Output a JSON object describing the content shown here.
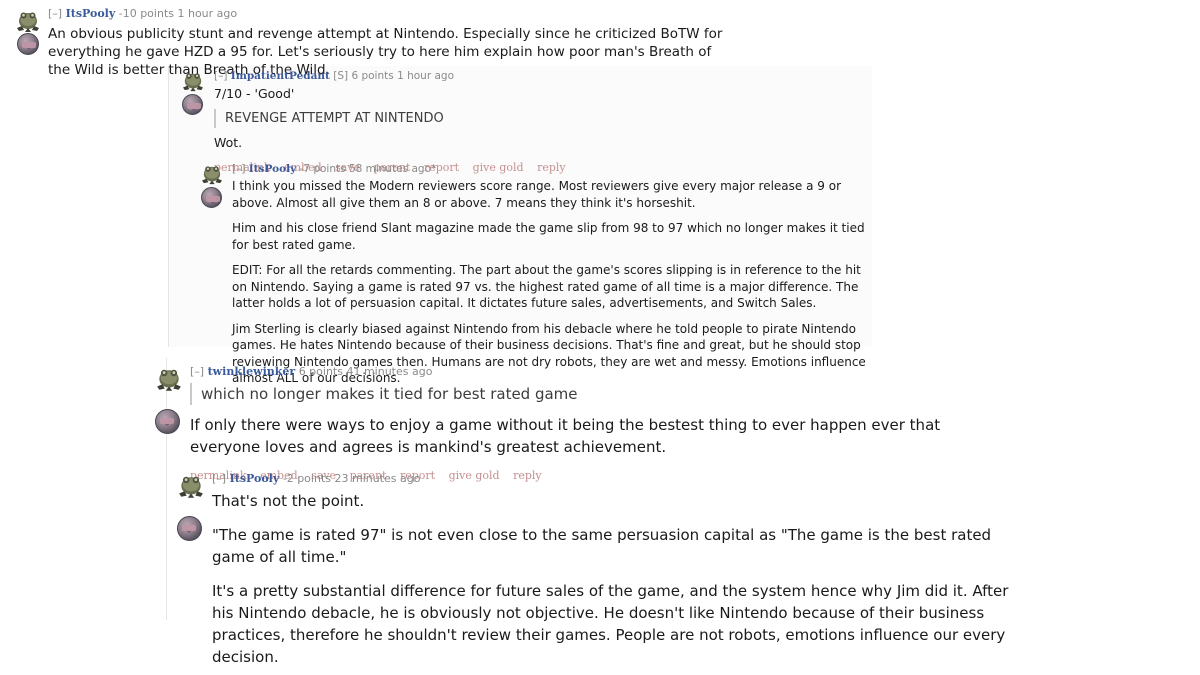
{
  "thread": {
    "comments": [
      {
        "id": "root",
        "collapse": "[–]",
        "author": "ItsPooly",
        "score": "-10 points",
        "time": "1 hour ago",
        "submitter": "",
        "body": [
          "An obvious publicity stunt and revenge attempt at Nintendo. Especially since he criticized BoTW for everything he gave HZD a 95 for. Let's seriously try to here him explain how poor man's Breath of the Wild is better than Breath of the Wild."
        ],
        "quote": "",
        "actions": []
      },
      {
        "id": "reply-1",
        "collapse": "[–]",
        "author": "ImpatientPedant",
        "submitter": "[S]",
        "score": "6 points",
        "time": "1 hour ago",
        "body_before_quote": "7/10 - 'Good'",
        "quote": "REVENGE ATTEMPT AT NINTENDO",
        "body_after_quote": "Wot.",
        "actions": [
          "permalink",
          "embed",
          "save",
          "parent",
          "report",
          "give gold",
          "reply"
        ]
      },
      {
        "id": "reply-2",
        "collapse": "[–]",
        "author": "ItsPooly",
        "submitter": "",
        "score": "-7 points",
        "time": "58 minutes ago*",
        "body": [
          "I think you missed the Modern reviewers score range. Most reviewers give every major release a 9 or above. Almost all give them an 8 or above. 7 means they think it's horseshit.",
          "Him and his close friend Slant magazine made the game slip from 98 to 97 which no longer makes it tied for best rated game.",
          "EDIT: For all the retards commenting. The part about the game's scores slipping is in reference to the hit on Nintendo. Saying a game is rated 97 vs. the highest rated game of all time is a major difference. The latter holds a lot of persuasion capital. It dictates future sales, advertisements, and Switch Sales.",
          "Jim Sterling is clearly biased against Nintendo from his debacle where he told people to pirate Nintendo games. He hates Nintendo because of their business decisions. That's fine and great, but he should stop reviewing Nintendo games then. Humans are not dry robots, they are wet and messy. Emotions influence almost ALL of our decisions."
        ],
        "actions": []
      },
      {
        "id": "reply-3",
        "collapse": "[–]",
        "author": "twinklewinker",
        "submitter": "",
        "score": "6 points",
        "time": "41 minutes ago",
        "quote": "which no longer makes it tied for best rated game",
        "body": [
          "If only there were ways to enjoy a game without it being the bestest thing to ever happen ever that everyone loves and agrees is mankind's greatest achievement."
        ],
        "actions": [
          "permalink",
          "embed",
          "save",
          "parent",
          "report",
          "give gold",
          "reply"
        ]
      },
      {
        "id": "reply-4",
        "collapse": "[–]",
        "author": "ItsPooly",
        "submitter": "",
        "score": "-2 points",
        "time": "23 minutes ago",
        "body": [
          "That's not the point.",
          "\"The game is rated 97\" is not even close to the same persuasion capital as \"The game is the best rated game of all time.\"",
          "It's a pretty substantial difference for future sales of the game, and the system hence why Jim did it. After his Nintendo debacle, he is obviously not objective. He doesn't like Nintendo because of their business practices, therefore he shouldn't review their games. People are not robots, emotions influence our every decision."
        ],
        "actions": []
      }
    ]
  },
  "colors": {
    "author_link": "#3b5a9a",
    "meta_grey": "#8a8a8a",
    "action_link": "#c4908f",
    "body_text": "#1a1a1a",
    "nested_bg": "#fbfbfb",
    "quote_bar": "#c9c9c9"
  }
}
